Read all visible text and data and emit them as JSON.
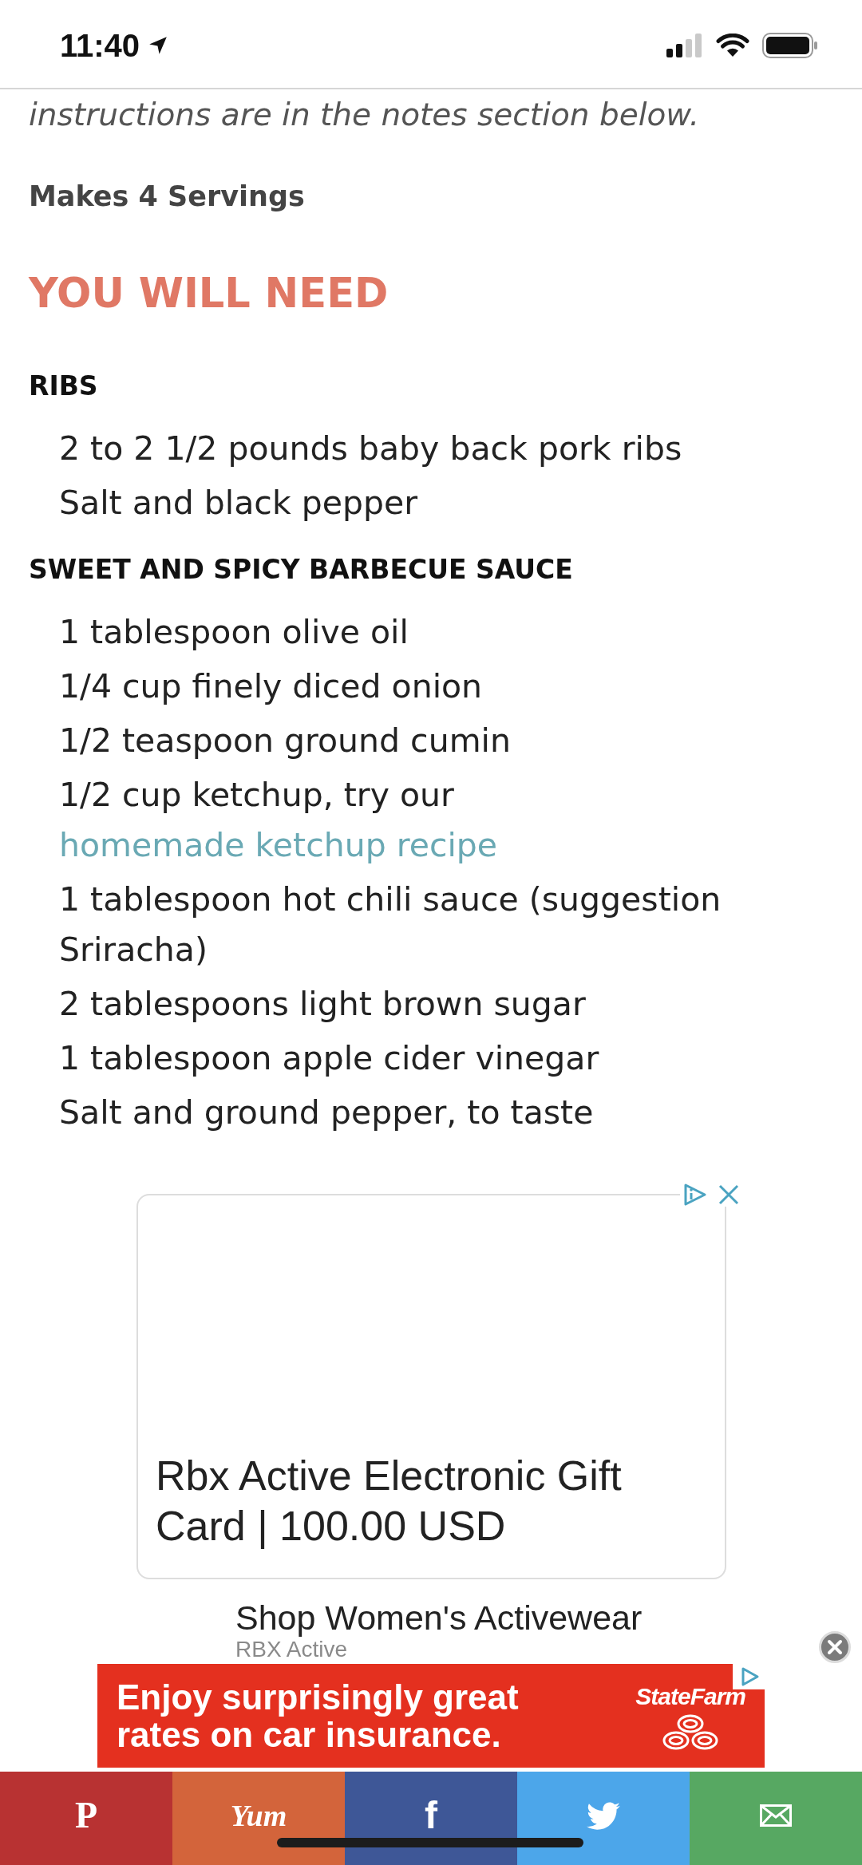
{
  "status_bar": {
    "time": "11:40"
  },
  "intro": "instructions are in the notes section below.",
  "servings": "Makes 4 Servings",
  "heading": "YOU WILL NEED",
  "ingredient_groups": [
    {
      "title": "RIBS",
      "items": [
        {
          "text": "2 to 2 1/2 pounds baby back pork ribs"
        },
        {
          "text": "Salt and black pepper"
        }
      ]
    },
    {
      "title": "SWEET AND SPICY BARBECUE SAUCE",
      "items": [
        {
          "text": "1 tablespoon olive oil"
        },
        {
          "text": "1/4 cup finely diced onion"
        },
        {
          "text": "1/2 teaspoon ground cumin"
        },
        {
          "text": "1/2 cup ketchup, try our ",
          "link": "homemade ketchup recipe"
        },
        {
          "text": "1 tablespoon hot chili sauce (suggestion Sriracha)"
        },
        {
          "text": "2 tablespoons light brown sugar"
        },
        {
          "text": "1 tablespoon apple cider vinegar"
        },
        {
          "text": "Salt and ground pepper, to taste"
        }
      ]
    }
  ],
  "ad_card": {
    "title": "Rbx Active Electronic Gift Card | 100.00 USD"
  },
  "ad_text": {
    "headline": "Shop Women's Activewear",
    "advertiser": "RBX Active"
  },
  "banner_ad": {
    "text": "Enjoy surprisingly great rates on car insurance.",
    "brand": "StateFarm"
  },
  "share_bar": [
    {
      "kind": "pin",
      "label": "P",
      "color": "#b83232"
    },
    {
      "kind": "yum",
      "label": "Yum",
      "color": "#d3643b"
    },
    {
      "kind": "fb",
      "label": "f",
      "color": "#3e5797"
    },
    {
      "kind": "bird",
      "color": "#4ca6ea"
    },
    {
      "kind": "mail",
      "color": "#57a862"
    }
  ]
}
